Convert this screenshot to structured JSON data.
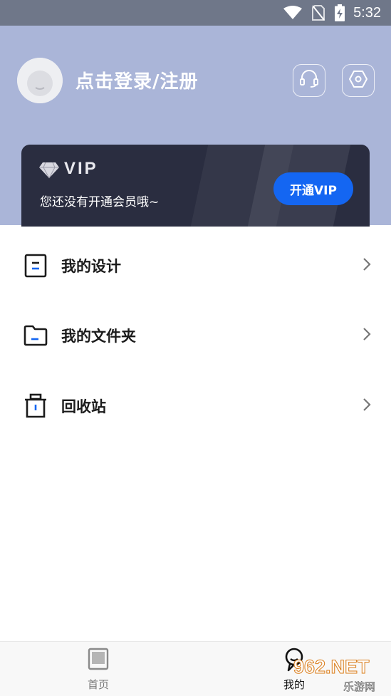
{
  "status_bar": {
    "time": "5:32",
    "icons": [
      "wifi-icon",
      "no-sim-icon",
      "battery-charging-icon"
    ]
  },
  "header": {
    "login_text": "点击登录/注册",
    "service_icon": "headset-icon",
    "settings_icon": "settings-hexagon-icon"
  },
  "vip": {
    "title": "VIP",
    "subtitle": "您还没有开通会员哦~",
    "button_label": "开通VIP"
  },
  "menu": [
    {
      "label": "我的设计",
      "icon": "design-doc-icon"
    },
    {
      "label": "我的文件夹",
      "icon": "folder-icon"
    },
    {
      "label": "回收站",
      "icon": "trash-icon"
    }
  ],
  "tabs": [
    {
      "label": "首页",
      "icon": "home-book-icon"
    },
    {
      "label": "我的",
      "icon": "profile-icon"
    }
  ],
  "watermark": {
    "main": "962.NET",
    "sub": "乐游网"
  },
  "colors": {
    "header_bg": "#aab5d8",
    "vip_card_bg": "#2a2d40",
    "accent": "#1466f2"
  }
}
